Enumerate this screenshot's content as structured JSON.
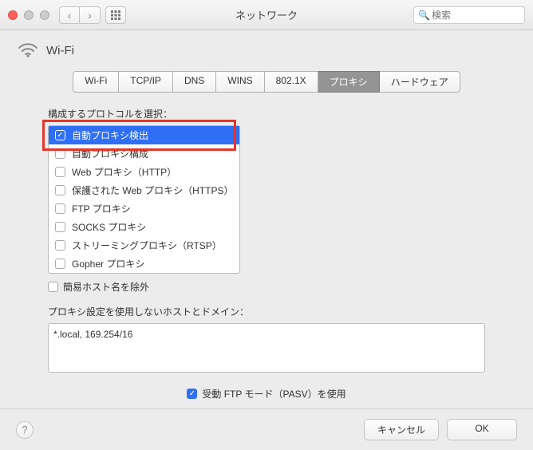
{
  "window": {
    "title": "ネットワーク"
  },
  "search": {
    "placeholder": "検索"
  },
  "header": {
    "title": "Wi-Fi"
  },
  "tabs": [
    {
      "label": "Wi-Fi"
    },
    {
      "label": "TCP/IP"
    },
    {
      "label": "DNS"
    },
    {
      "label": "WINS"
    },
    {
      "label": "802.1X"
    },
    {
      "label": "プロキシ"
    },
    {
      "label": "ハードウェア"
    }
  ],
  "protocols": {
    "label": "構成するプロトコルを選択：",
    "items": [
      {
        "label": "自動プロキシ検出",
        "checked": true,
        "selected": true
      },
      {
        "label": "自動プロキシ構成",
        "checked": false
      },
      {
        "label": "Web プロキシ（HTTP）",
        "checked": false
      },
      {
        "label": "保護された Web プロキシ（HTTPS）",
        "checked": false
      },
      {
        "label": "FTP プロキシ",
        "checked": false
      },
      {
        "label": "SOCKS プロキシ",
        "checked": false
      },
      {
        "label": "ストリーミングプロキシ（RTSP）",
        "checked": false
      },
      {
        "label": "Gopher プロキシ",
        "checked": false
      }
    ]
  },
  "simple_hostnames": {
    "label": "簡易ホスト名を除外",
    "checked": false
  },
  "bypass": {
    "label": "プロキシ設定を使用しないホストとドメイン：",
    "value": "*.local, 169.254/16"
  },
  "pasv": {
    "label": "受動 FTP モード（PASV）を使用",
    "checked": true
  },
  "buttons": {
    "cancel": "キャンセル",
    "ok": "OK"
  }
}
